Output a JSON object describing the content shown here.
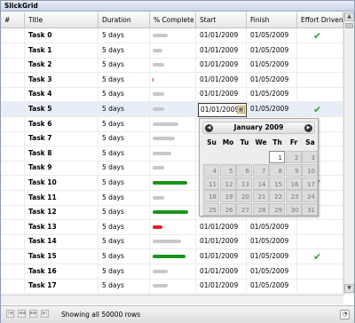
{
  "window": {
    "title": "SlickGrid"
  },
  "columns": [
    "#",
    "Title",
    "Duration",
    "% Complete",
    "Start",
    "Finish",
    "Effort Driven"
  ],
  "colors": {
    "progress_gray": "#c8c8c8",
    "progress_green": "#1a941a",
    "progress_red": "#e02020",
    "check": "#3ca03c"
  },
  "rows": [
    {
      "title": "Task 0",
      "duration": "5 days",
      "pct": 0.4,
      "color": "gray",
      "start": "01/01/2009",
      "finish": "01/05/2009",
      "effort": true
    },
    {
      "title": "Task 1",
      "duration": "5 days",
      "pct": 0.25,
      "color": "gray",
      "start": "01/01/2009",
      "finish": "01/05/2009",
      "effort": false
    },
    {
      "title": "Task 2",
      "duration": "5 days",
      "pct": 0.3,
      "color": "gray",
      "start": "01/01/2009",
      "finish": "01/05/2009",
      "effort": false
    },
    {
      "title": "Task 3",
      "duration": "5 days",
      "pct": 0.02,
      "color": "red",
      "start": "01/01/2009",
      "finish": "01/05/2009",
      "effort": false
    },
    {
      "title": "Task 4",
      "duration": "5 days",
      "pct": 0.3,
      "color": "gray",
      "start": "01/01/2009",
      "finish": "01/05/2009",
      "effort": false
    },
    {
      "title": "Task 5",
      "duration": "5 days",
      "pct": 0.3,
      "color": "gray",
      "start": "01/01/2009",
      "finish": "01/05/2009",
      "effort": true
    },
    {
      "title": "Task 6",
      "duration": "5 days",
      "pct": 0.7,
      "color": "gray",
      "start": "",
      "finish": "",
      "effort": false
    },
    {
      "title": "Task 7",
      "duration": "5 days",
      "pct": 0.6,
      "color": "gray",
      "start": "",
      "finish": "",
      "effort": false
    },
    {
      "title": "Task 8",
      "duration": "5 days",
      "pct": 0.5,
      "color": "gray",
      "start": "",
      "finish": "",
      "effort": false
    },
    {
      "title": "Task 9",
      "duration": "5 days",
      "pct": 0.3,
      "color": "gray",
      "start": "",
      "finish": "",
      "effort": false
    },
    {
      "title": "Task 10",
      "duration": "5 days",
      "pct": 0.92,
      "color": "green",
      "start": "",
      "finish": "",
      "effort": true
    },
    {
      "title": "Task 11",
      "duration": "5 days",
      "pct": 0.3,
      "color": "gray",
      "start": "",
      "finish": "",
      "effort": false
    },
    {
      "title": "Task 12",
      "duration": "5 days",
      "pct": 0.95,
      "color": "green",
      "start": "",
      "finish": "",
      "effort": false
    },
    {
      "title": "Task 13",
      "duration": "5 days",
      "pct": 0.25,
      "color": "red",
      "start": "01/01/2009",
      "finish": "01/05/2009",
      "effort": false
    },
    {
      "title": "Task 14",
      "duration": "5 days",
      "pct": 0.75,
      "color": "gray",
      "start": "01/01/2009",
      "finish": "01/05/2009",
      "effort": false
    },
    {
      "title": "Task 15",
      "duration": "5 days",
      "pct": 0.88,
      "color": "green",
      "start": "01/01/2009",
      "finish": "01/05/2009",
      "effort": true
    },
    {
      "title": "Task 16",
      "duration": "5 days",
      "pct": 0.4,
      "color": "gray",
      "start": "01/01/2009",
      "finish": "01/05/2009",
      "effort": false
    },
    {
      "title": "Task 17",
      "duration": "5 days",
      "pct": 0.4,
      "color": "gray",
      "start": "01/01/2009",
      "finish": "01/05/2009",
      "effort": false
    }
  ],
  "active_row": 5,
  "editor": {
    "value": "01/01/2009"
  },
  "calendar": {
    "month_label": "January 2009",
    "weekdays": [
      "Su",
      "Mo",
      "Tu",
      "We",
      "Th",
      "Fr",
      "Sa"
    ],
    "weeks": [
      [
        "",
        "",
        "",
        "",
        "1",
        "2",
        "3"
      ],
      [
        "4",
        "5",
        "6",
        "7",
        "8",
        "9",
        "10"
      ],
      [
        "11",
        "12",
        "13",
        "14",
        "15",
        "16",
        "17"
      ],
      [
        "18",
        "19",
        "20",
        "21",
        "22",
        "23",
        "24"
      ],
      [
        "25",
        "26",
        "27",
        "28",
        "29",
        "30",
        "31"
      ]
    ],
    "selected_day": "1",
    "prev_icon": "prev-month-icon",
    "next_icon": "next-month-icon"
  },
  "pager": {
    "status": "Showing all 50000 rows"
  }
}
